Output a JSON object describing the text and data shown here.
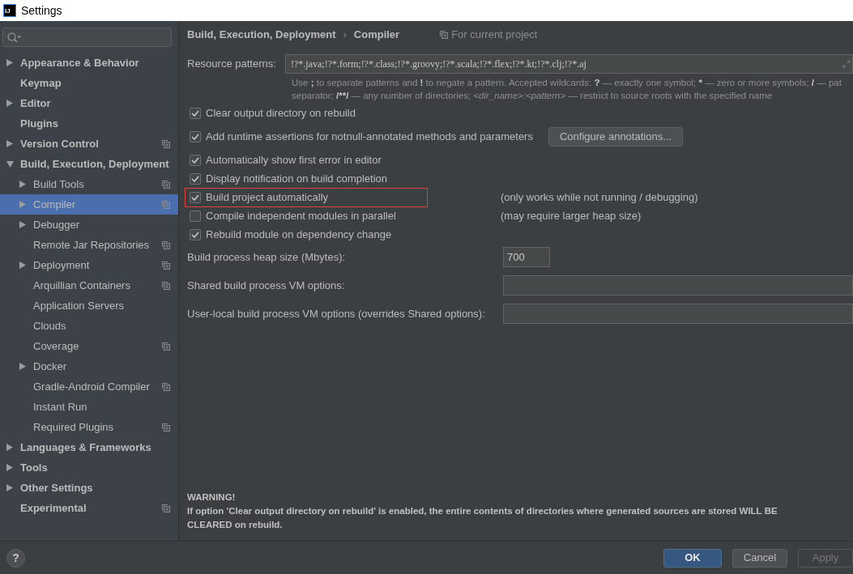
{
  "window": {
    "title": "Settings",
    "icon_label": "IJ"
  },
  "sidebar": {
    "items": [
      {
        "label": "Appearance & Behavior",
        "expanded": false,
        "selected": false,
        "per_project": false
      },
      {
        "label": "Keymap",
        "selected": false,
        "per_project": false
      },
      {
        "label": "Editor",
        "expanded": false,
        "selected": false,
        "per_project": false
      },
      {
        "label": "Plugins",
        "selected": false,
        "per_project": false
      },
      {
        "label": "Version Control",
        "expanded": false,
        "selected": false,
        "per_project": true
      },
      {
        "label": "Build, Execution, Deployment",
        "expanded": true,
        "selected": false,
        "per_project": false,
        "children": [
          {
            "label": "Build Tools",
            "expanded": false,
            "selected": false,
            "per_project": true
          },
          {
            "label": "Compiler",
            "expanded": false,
            "selected": true,
            "per_project": true
          },
          {
            "label": "Debugger",
            "expanded": false,
            "selected": false,
            "per_project": false
          },
          {
            "label": "Remote Jar Repositories",
            "selected": false,
            "per_project": true
          },
          {
            "label": "Deployment",
            "expanded": false,
            "selected": false,
            "per_project": true
          },
          {
            "label": "Arquillian Containers",
            "selected": false,
            "per_project": true
          },
          {
            "label": "Application Servers",
            "selected": false,
            "per_project": false
          },
          {
            "label": "Clouds",
            "selected": false,
            "per_project": false
          },
          {
            "label": "Coverage",
            "selected": false,
            "per_project": true
          },
          {
            "label": "Docker",
            "expanded": false,
            "selected": false,
            "per_project": false
          },
          {
            "label": "Gradle-Android Compiler",
            "selected": false,
            "per_project": true
          },
          {
            "label": "Instant Run",
            "selected": false,
            "per_project": false
          },
          {
            "label": "Required Plugins",
            "selected": false,
            "per_project": true
          }
        ]
      },
      {
        "label": "Languages & Frameworks",
        "expanded": false,
        "selected": false,
        "per_project": false
      },
      {
        "label": "Tools",
        "expanded": false,
        "selected": false,
        "per_project": false
      },
      {
        "label": "Other Settings",
        "expanded": false,
        "selected": false,
        "per_project": false
      },
      {
        "label": "Experimental",
        "selected": false,
        "per_project": true
      }
    ]
  },
  "breadcrumb": {
    "items": [
      "Build, Execution, Deployment",
      "Compiler"
    ],
    "separator": "›"
  },
  "scope": {
    "label": "For current project"
  },
  "resource_patterns": {
    "label": "Resource patterns:",
    "value": "!?*.java;!?*.form;!?*.class;!?*.groovy;!?*.scala;!?*.flex;!?*.kt;!?*.clj;!?*.aj",
    "hint_lines": [
      [
        {
          "text": "Use ",
          "kind": "plain"
        },
        {
          "text": ";",
          "kind": "bold"
        },
        {
          "text": " to separate patterns and ",
          "kind": "plain"
        },
        {
          "text": "!",
          "kind": "bold"
        },
        {
          "text": " to negate a pattern. Accepted wildcards: ",
          "kind": "plain"
        },
        {
          "text": "?",
          "kind": "bold"
        },
        {
          "text": " — exactly one symbol; ",
          "kind": "plain"
        },
        {
          "text": "*",
          "kind": "bold"
        },
        {
          "text": " — zero or more symbols; ",
          "kind": "plain"
        },
        {
          "text": "/",
          "kind": "bold"
        },
        {
          "text": " — pat",
          "kind": "plain"
        }
      ],
      [
        {
          "text": "separator; ",
          "kind": "plain"
        },
        {
          "text": "/**/",
          "kind": "bold"
        },
        {
          "text": " — any number of directories; ",
          "kind": "plain"
        },
        {
          "text": "<dir_name>:<pattern>",
          "kind": "italic"
        },
        {
          "text": " — restrict to source roots with the specified name",
          "kind": "plain"
        }
      ]
    ]
  },
  "options": [
    {
      "label": "Clear output directory on rebuild",
      "checked": true,
      "highlighted": false
    },
    {
      "label": "Add runtime assertions for notnull-annotated methods and parameters",
      "checked": true,
      "highlighted": false,
      "button": "Configure annotations..."
    },
    {
      "label": "Automatically show first error in editor",
      "checked": true,
      "highlighted": false
    },
    {
      "label": "Display notification on build completion",
      "checked": true,
      "highlighted": false
    },
    {
      "label": "Build project automatically",
      "checked": true,
      "highlighted": true,
      "note": "(only works while not running / debugging)"
    },
    {
      "label": "Compile independent modules in parallel",
      "checked": false,
      "highlighted": false,
      "note": "(may require larger heap size)"
    },
    {
      "label": "Rebuild module on dependency change",
      "checked": true,
      "highlighted": false
    }
  ],
  "build_settings": [
    {
      "label": "Build process heap size (Mbytes):",
      "value": "700",
      "kind": "short"
    },
    {
      "label": "Shared build process VM options:",
      "kind": "wide"
    },
    {
      "label": "User-local build process VM options (overrides Shared options):",
      "kind": "wide"
    }
  ],
  "warning": {
    "title": "WARNING!",
    "lines": [
      "If option 'Clear output directory on rebuild' is enabled, the entire contents of directories where generated sources are stored WILL BE",
      "CLEARED on rebuild."
    ]
  },
  "footer": {
    "help": "?",
    "buttons": [
      {
        "label": "OK",
        "kind": "default",
        "disabled": false
      },
      {
        "label": "Cancel",
        "kind": "normal",
        "disabled": false
      },
      {
        "label": "Apply",
        "kind": "normal",
        "disabled": true
      }
    ]
  }
}
